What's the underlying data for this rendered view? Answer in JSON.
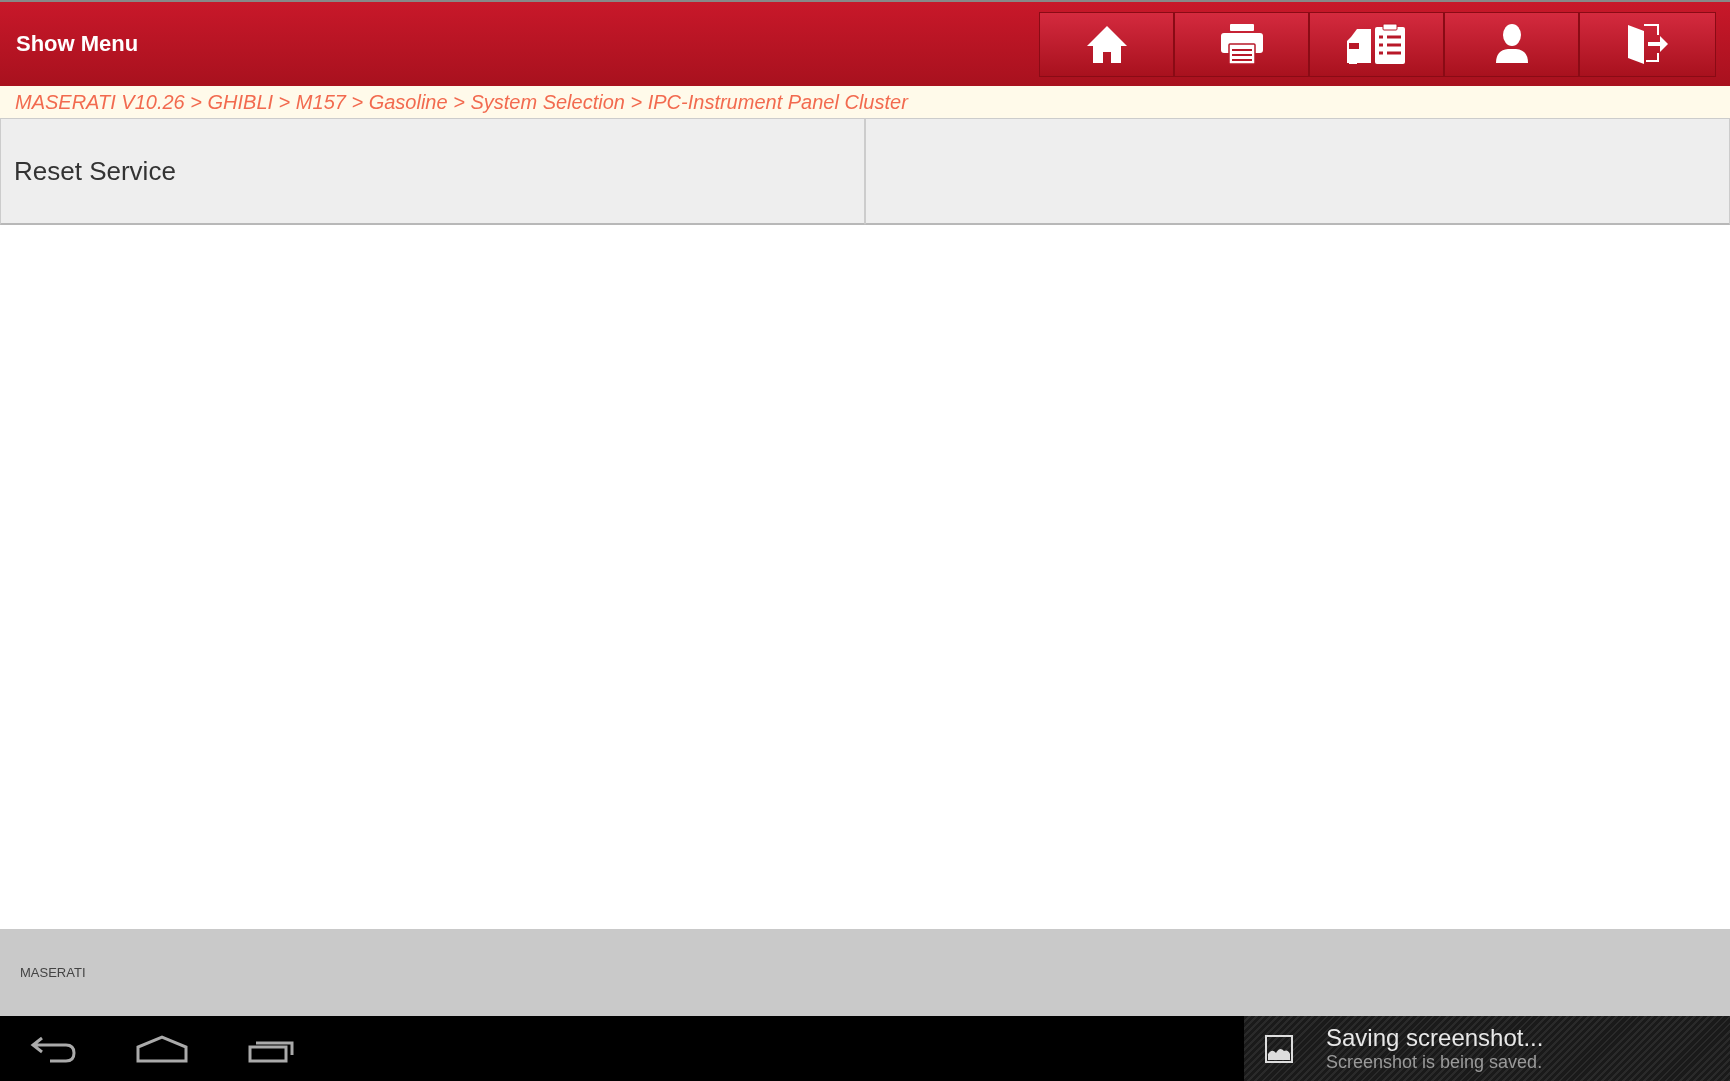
{
  "header": {
    "menu_label": "Show Menu",
    "buttons": [
      {
        "kind": "home"
      },
      {
        "kind": "print"
      },
      {
        "kind": "report"
      },
      {
        "kind": "user"
      },
      {
        "kind": "exit"
      }
    ]
  },
  "breadcrumb": "MASERATI V10.26 > GHIBLI > M157 > Gasoline > System Selection > IPC-Instrument Panel Cluster",
  "functions": [
    {
      "label": "Reset Service"
    }
  ],
  "footer": {
    "brand": "MASERATI"
  },
  "notification": {
    "title": "Saving screenshot...",
    "text": "Screenshot is being saved."
  }
}
